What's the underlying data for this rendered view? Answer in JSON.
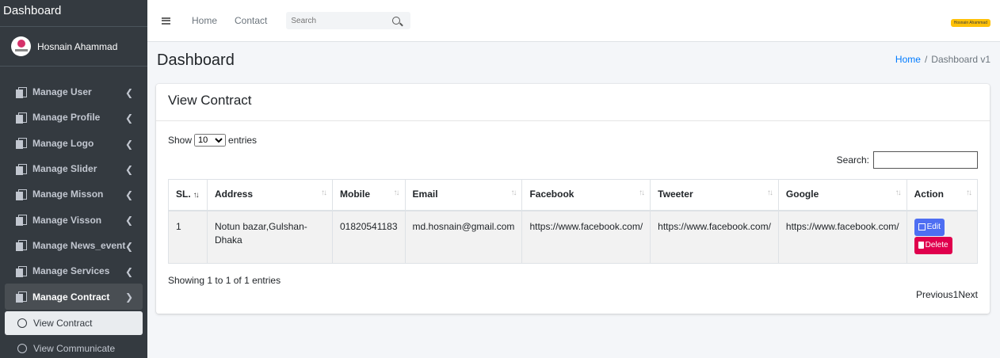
{
  "sidebar": {
    "brand": "Dashboard",
    "user_name": "Hosnain Ahammad",
    "menu": [
      {
        "label": "Manage User"
      },
      {
        "label": "Manage Profile"
      },
      {
        "label": "Manage Logo"
      },
      {
        "label": "Manage Slider"
      },
      {
        "label": "Manage Misson"
      },
      {
        "label": "Manage Visson"
      },
      {
        "label": "Manage News_event"
      },
      {
        "label": "Manage Services"
      },
      {
        "label": "Manage Contract"
      }
    ],
    "submenu": [
      {
        "label": "View Contract"
      },
      {
        "label": "View Communicate"
      }
    ]
  },
  "navbar": {
    "home": "Home",
    "contact": "Contact",
    "search_placeholder": "Search",
    "user_badge": "Hosnain Ahammad"
  },
  "header": {
    "title": "Dashboard",
    "breadcrumb_home": "Home",
    "breadcrumb_sep": "/",
    "breadcrumb_current": "Dashboard v1"
  },
  "card": {
    "title": "View Contract",
    "show_label": "Show",
    "entries_label": "entries",
    "page_size": "10",
    "search_label": "Search:",
    "columns": [
      "SL.",
      "Address",
      "Mobile",
      "Email",
      "Facebook",
      "Tweeter",
      "Google",
      "Action"
    ],
    "rows": [
      {
        "sl": "1",
        "address": "Notun bazar,Gulshan-Dhaka",
        "mobile": "01820541183",
        "email": "md.hosnain@gmail.com",
        "facebook": "https://www.facebook.com/",
        "tweeter": "https://www.facebook.com/",
        "google": "https://www.facebook.com/",
        "edit": "Edit",
        "delete": "Delete"
      }
    ],
    "info": "Showing 1 to 1 of 1 entries",
    "previous": "Previous",
    "page": "1",
    "next": "Next"
  }
}
